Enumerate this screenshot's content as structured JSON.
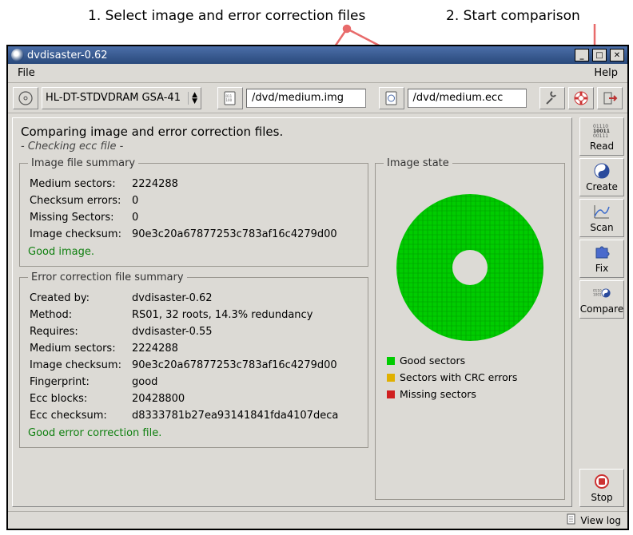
{
  "annotations": {
    "step1": "1. Select image and error correction files",
    "step2": "2. Start comparison"
  },
  "window": {
    "title": "dvdisaster-0.62"
  },
  "menu": {
    "file": "File",
    "help": "Help"
  },
  "toolbar": {
    "drive": "HL-DT-STDVDRAM GSA-41",
    "img_path": "/dvd/medium.img",
    "ecc_path": "/dvd/medium.ecc"
  },
  "main": {
    "title": "Comparing image and error correction files.",
    "subtitle": "- Checking ecc file -",
    "image_summary_legend": "Image file summary",
    "image_state_legend": "Image state",
    "ecc_summary_legend": "Error correction file summary",
    "image": {
      "k_medium_sectors": "Medium sectors:",
      "v_medium_sectors": "2224288",
      "k_checksum_errors": "Checksum errors:",
      "v_checksum_errors": "0",
      "k_missing_sectors": "Missing Sectors:",
      "v_missing_sectors": "0",
      "k_img_checksum": "Image checksum:",
      "v_img_checksum": "90e3c20a67877253c783af16c4279d00",
      "good": "Good image."
    },
    "ecc": {
      "k_created": "Created by:",
      "v_created": "dvdisaster-0.62",
      "k_method": "Method:",
      "v_method": "RS01, 32 roots, 14.3% redundancy",
      "k_requires": "Requires:",
      "v_requires": "dvdisaster-0.55",
      "k_medium_sectors": "Medium sectors:",
      "v_medium_sectors": "2224288",
      "k_img_checksum": "Image checksum:",
      "v_img_checksum": "90e3c20a67877253c783af16c4279d00",
      "k_fingerprint": "Fingerprint:",
      "v_fingerprint": "good",
      "k_ecc_blocks": "Ecc blocks:",
      "v_ecc_blocks": "20428800",
      "k_ecc_checksum": "Ecc checksum:",
      "v_ecc_checksum": "d8333781b27ea93141841fda4107deca",
      "good": "Good error correction file."
    },
    "legend": {
      "good": "Good sectors",
      "crc": "Sectors with CRC errors",
      "missing": "Missing sectors"
    }
  },
  "side": {
    "read": "Read",
    "create": "Create",
    "scan": "Scan",
    "fix": "Fix",
    "compare": "Compare",
    "stop": "Stop"
  },
  "status": {
    "viewlog": "View log"
  },
  "chart_data": {
    "type": "pie",
    "title": "Image state (sector health)",
    "series": [
      {
        "name": "Good sectors",
        "value": 2224288,
        "color": "#00cc00"
      },
      {
        "name": "Sectors with CRC errors",
        "value": 0,
        "color": "#e0b000"
      },
      {
        "name": "Missing sectors",
        "value": 0,
        "color": "#d02020"
      }
    ],
    "total_sectors": 2224288
  }
}
